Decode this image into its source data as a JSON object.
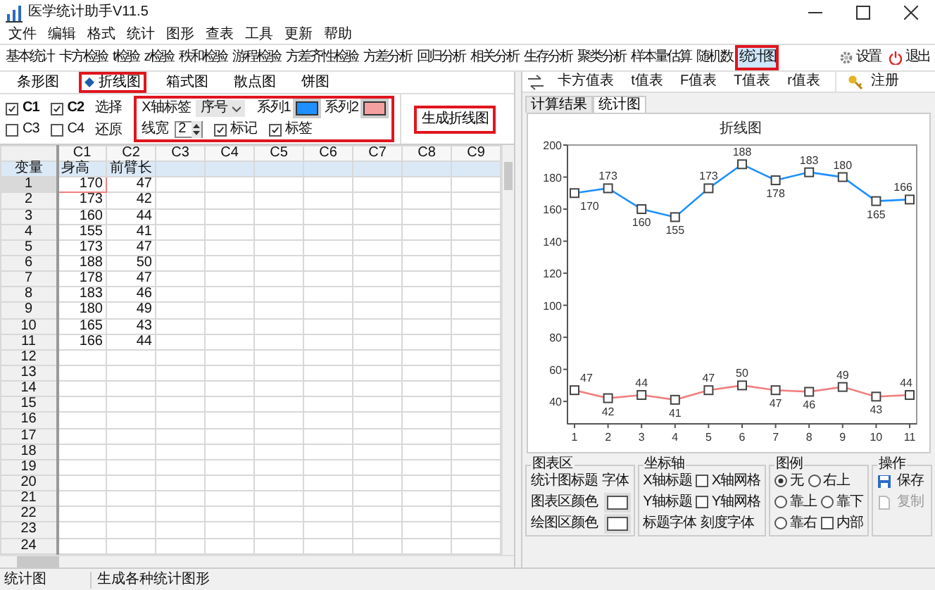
{
  "window": {
    "title": "医学统计助手V11.5"
  },
  "menu": [
    "文件",
    "编辑",
    "格式",
    "统计",
    "图形",
    "查表",
    "工具",
    "更新",
    "帮助"
  ],
  "toolbar": [
    {
      "label": "基本统计",
      "selected": false
    },
    {
      "label": "卡方检验",
      "selected": false
    },
    {
      "label": "t检验",
      "selected": false
    },
    {
      "label": "z检验",
      "selected": false
    },
    {
      "label": "秩和检验",
      "selected": false
    },
    {
      "label": "游程检验",
      "selected": false
    },
    {
      "label": "方差齐性检验",
      "selected": false
    },
    {
      "label": "方差分析",
      "selected": false
    },
    {
      "label": "回归分析",
      "selected": false
    },
    {
      "label": "相关分析",
      "selected": false
    },
    {
      "label": "生存分析",
      "selected": false
    },
    {
      "label": "聚类分析",
      "selected": false
    },
    {
      "label": "样本量估算",
      "selected": false
    },
    {
      "label": "随机数",
      "selected": false
    },
    {
      "label": "统计图",
      "selected": true
    }
  ],
  "toolbar_right": [
    {
      "kind": "settings",
      "label": "设置"
    },
    {
      "kind": "exit",
      "label": "退出"
    }
  ],
  "chart_types": [
    {
      "label": "条形图",
      "selected": false
    },
    {
      "label": "折线图",
      "selected": true
    },
    {
      "label": "箱式图",
      "selected": false
    },
    {
      "label": "散点图",
      "selected": false
    },
    {
      "label": "饼图",
      "selected": false
    }
  ],
  "column_checks": [
    {
      "label": "C1",
      "checked": true
    },
    {
      "label": "C2",
      "checked": true
    },
    {
      "label": "C3",
      "checked": false
    },
    {
      "label": "C4",
      "checked": false
    }
  ],
  "column_actions": [
    "选择",
    "还原"
  ],
  "line_options": {
    "x_label_caption": "X轴标签",
    "x_label_value": "序号",
    "series": [
      {
        "label": "系列1",
        "color": "#1e90ff"
      },
      {
        "label": "系列2",
        "color": "#f4a0a0"
      }
    ],
    "width_caption": "线宽",
    "width_value": "2",
    "toggles": [
      {
        "label": "标记",
        "checked": true
      },
      {
        "label": "标签",
        "checked": true
      }
    ]
  },
  "generate_button": "生成折线图",
  "table": {
    "columns": [
      "C1",
      "C2",
      "C3",
      "C4",
      "C5",
      "C6",
      "C7",
      "C8",
      "C9"
    ],
    "variable_row": {
      "label": "变量",
      "cells": [
        "身高",
        "前臂长"
      ]
    },
    "rows": [
      {
        "label": "1",
        "cells": [
          "170",
          "47"
        ],
        "selected": true
      },
      {
        "label": "2",
        "cells": [
          "173",
          "42"
        ],
        "selected": false
      },
      {
        "label": "3",
        "cells": [
          "160",
          "44"
        ],
        "selected": false
      },
      {
        "label": "4",
        "cells": [
          "155",
          "41"
        ],
        "selected": false
      },
      {
        "label": "5",
        "cells": [
          "173",
          "47"
        ],
        "selected": false
      },
      {
        "label": "6",
        "cells": [
          "188",
          "50"
        ],
        "selected": false
      },
      {
        "label": "7",
        "cells": [
          "178",
          "47"
        ],
        "selected": false
      },
      {
        "label": "8",
        "cells": [
          "183",
          "46"
        ],
        "selected": false
      },
      {
        "label": "9",
        "cells": [
          "180",
          "49"
        ],
        "selected": false
      },
      {
        "label": "10",
        "cells": [
          "165",
          "43"
        ],
        "selected": false
      },
      {
        "label": "11",
        "cells": [
          "166",
          "44"
        ],
        "selected": false
      },
      {
        "label": "12",
        "selected": false
      },
      {
        "label": "13",
        "selected": false
      },
      {
        "label": "14",
        "selected": false
      },
      {
        "label": "15",
        "selected": false
      },
      {
        "label": "16",
        "selected": false
      },
      {
        "label": "17",
        "selected": false
      },
      {
        "label": "18",
        "selected": false
      },
      {
        "label": "19",
        "selected": false
      },
      {
        "label": "20",
        "selected": false
      },
      {
        "label": "21",
        "selected": false
      },
      {
        "label": "22",
        "selected": false
      },
      {
        "label": "23",
        "selected": false
      },
      {
        "label": "24",
        "selected": false
      }
    ]
  },
  "tables_toolbar": [
    "卡方值表",
    "t值表",
    "F值表",
    "T值表",
    "r值表"
  ],
  "register_button": "注册",
  "result_tabs": [
    {
      "label": "计算结果",
      "selected": false
    },
    {
      "label": "统计图",
      "selected": true
    }
  ],
  "chart": {
    "chart_data": {
      "type": "line",
      "title": "折线图",
      "categories": [
        "1",
        "2",
        "3",
        "4",
        "5",
        "6",
        "7",
        "8",
        "9",
        "10",
        "11"
      ],
      "series": [
        {
          "color": "#1e90ff",
          "marker": true,
          "values": [
            170,
            173,
            160,
            155,
            173,
            188,
            178,
            183,
            180,
            165,
            166
          ]
        },
        {
          "color": "#f08080",
          "marker": true,
          "values": [
            47,
            42,
            44,
            41,
            47,
            50,
            47,
            46,
            49,
            43,
            44
          ]
        }
      ],
      "ylim": [
        26,
        200
      ],
      "yticks": [
        40,
        60,
        80,
        100,
        120,
        140,
        160,
        180,
        200
      ],
      "data_labels": true
    }
  },
  "option_groups": [
    {
      "title": "图表区",
      "rows": [
        [
          {
            "kind": "text",
            "label": "统计图标题"
          },
          {
            "kind": "text",
            "label": "字体"
          }
        ],
        [
          {
            "kind": "text",
            "label": "图表区颜色"
          },
          {
            "kind": "swatch"
          }
        ],
        [
          {
            "kind": "text",
            "label": "绘图区颜色"
          },
          {
            "kind": "swatch"
          }
        ]
      ]
    },
    {
      "title": "坐标轴",
      "rows": [
        [
          {
            "kind": "text",
            "label": "X轴标题"
          },
          {
            "kind": "checkbox",
            "label": "X轴网格",
            "checked": false
          }
        ],
        [
          {
            "kind": "text",
            "label": "Y轴标题"
          },
          {
            "kind": "checkbox",
            "label": "Y轴网格",
            "checked": false
          }
        ],
        [
          {
            "kind": "text",
            "label": "标题字体"
          },
          {
            "kind": "text",
            "label": "刻度字体"
          }
        ]
      ]
    },
    {
      "title": "图例",
      "rows": [
        [
          {
            "kind": "radio",
            "label": "无",
            "selected": true
          },
          {
            "kind": "radio",
            "label": "右上",
            "selected": false
          }
        ],
        [
          {
            "kind": "radio",
            "label": "靠上",
            "selected": false
          },
          {
            "kind": "radio",
            "label": "靠下",
            "selected": false
          }
        ],
        [
          {
            "kind": "radio",
            "label": "靠右",
            "selected": false
          },
          {
            "kind": "checkbox",
            "label": "内部",
            "checked": false
          }
        ]
      ]
    },
    {
      "title": "操作",
      "rows": [
        [
          {
            "kind": "save",
            "label": "保存",
            "disabled": false
          }
        ],
        [
          {
            "kind": "copy",
            "label": "复制",
            "disabled": true
          }
        ]
      ]
    }
  ],
  "status_bar": [
    "统计图",
    "生成各种统计图形"
  ]
}
